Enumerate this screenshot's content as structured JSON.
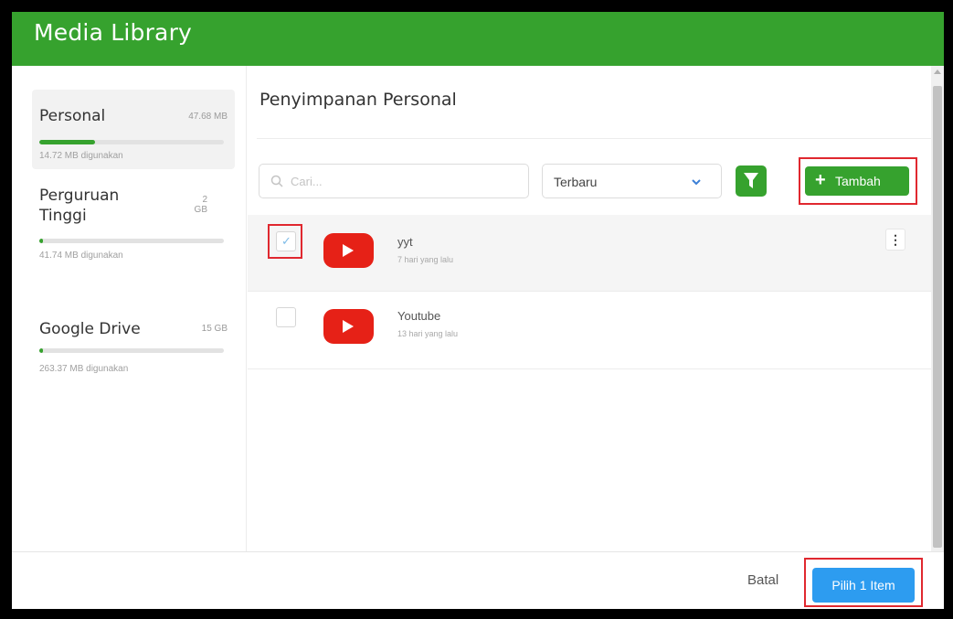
{
  "app": {
    "title": "Media Library"
  },
  "sidebar": {
    "storages": [
      {
        "name": "Personal",
        "capacity": "47.68 MB",
        "used": "14.72 MB digunakan",
        "usage_fraction": 0.3,
        "active": true
      },
      {
        "name": "Perguruan Tinggi",
        "name_line1": "Perguruan",
        "name_line2": "Tinggi",
        "capacity": "2 GB",
        "capacity_line1": "2",
        "capacity_line2": "GB",
        "used": "41.74 MB digunakan",
        "usage_fraction": 0.02,
        "active": false
      },
      {
        "name": "Google Drive",
        "capacity": "15 GB",
        "used": "263.37 MB digunakan",
        "usage_fraction": 0.02,
        "active": false
      }
    ]
  },
  "main": {
    "heading": "Penyimpanan Personal",
    "search": {
      "placeholder": "Cari...",
      "value": ""
    },
    "sort": {
      "selected": "Terbaru"
    },
    "add_button": {
      "label": "Tambah"
    },
    "files": [
      {
        "name": "yyt",
        "time": "7 hari yang lalu",
        "selected": true,
        "icon": "youtube-icon"
      },
      {
        "name": "Youtube",
        "time": "13 hari yang lalu",
        "selected": false,
        "icon": "youtube-icon"
      }
    ]
  },
  "footer": {
    "cancel_label": "Batal",
    "choose_label": "Pilih 1 Item"
  },
  "colors": {
    "brand_green": "#36a22e",
    "primary_blue": "#2d9cf0",
    "youtube_red": "#e62117",
    "highlight_red": "#e0282f"
  }
}
